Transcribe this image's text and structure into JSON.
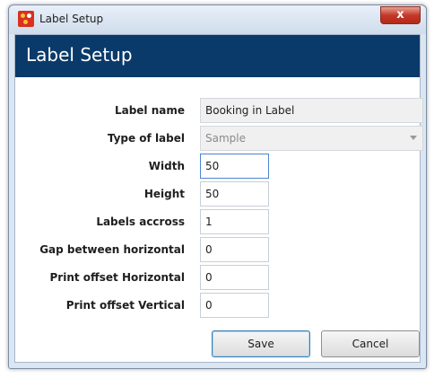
{
  "window": {
    "title": "Label Setup",
    "close_label": "x"
  },
  "header": {
    "title": "Label Setup"
  },
  "form": {
    "label_name": {
      "label": "Label name",
      "value": "Booking in Label"
    },
    "type_of_label": {
      "label": "Type of label",
      "value": "Sample"
    },
    "width": {
      "label": "Width",
      "value": "50"
    },
    "height": {
      "label": "Height",
      "value": "50"
    },
    "labels_across": {
      "label": "Labels accross",
      "value": "1"
    },
    "gap_horizontal": {
      "label": "Gap between horizontal",
      "value": "0"
    },
    "offset_horizontal": {
      "label": "Print offset Horizontal",
      "value": "0"
    },
    "offset_vertical": {
      "label": "Print offset Vertical",
      "value": "0"
    }
  },
  "buttons": {
    "save_label": "Save",
    "cancel_label": "Cancel"
  },
  "colors": {
    "header_bg": "#0a3a6a",
    "close_button": "#c4392a",
    "focus_border": "#4a86d0"
  },
  "icons": {
    "app": "app-logo-icon",
    "dropdown": "chevron-down-icon",
    "close": "close-icon"
  }
}
